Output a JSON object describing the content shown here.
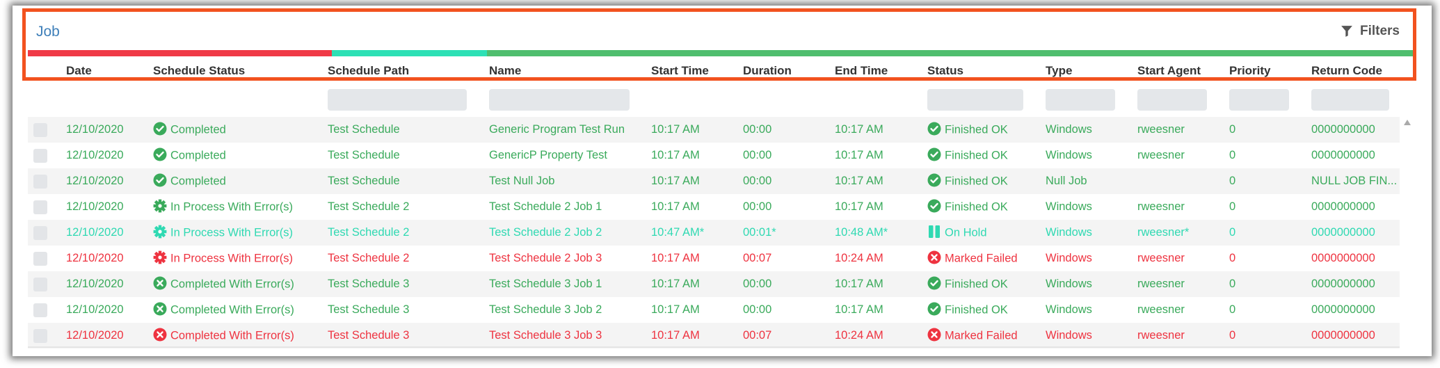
{
  "title": "Job",
  "filters_label": "Filters",
  "colors": {
    "completed": "#3aaa5b",
    "onhold": "#2fd9b2",
    "failed": "#ee3340"
  },
  "status_bar": [
    {
      "color": "#f03a47"
    },
    {
      "color": "#2de0b5"
    },
    {
      "color": "#4fbe6e"
    }
  ],
  "columns": [
    "Date",
    "Schedule Status",
    "Schedule Path",
    "Name",
    "Start Time",
    "Duration",
    "End Time",
    "Status",
    "Type",
    "Start Agent",
    "Priority",
    "Return Code"
  ],
  "rows": [
    {
      "state": "green",
      "date": "12/10/2020",
      "sched_icon": "check-circle-icon",
      "sched_status": "Completed",
      "path": "Test Schedule",
      "name": "Generic Program Test Run",
      "start": "10:17 AM",
      "duration": "00:00",
      "end": "10:17 AM",
      "status_icon": "check-circle-icon",
      "status": "Finished OK",
      "type": "Windows",
      "agent": "rweesner",
      "priority": "0",
      "code": "0000000000"
    },
    {
      "state": "green",
      "date": "12/10/2020",
      "sched_icon": "check-circle-icon",
      "sched_status": "Completed",
      "path": "Test Schedule",
      "name": "GenericP Property Test",
      "start": "10:17 AM",
      "duration": "00:00",
      "end": "10:17 AM",
      "status_icon": "check-circle-icon",
      "status": "Finished OK",
      "type": "Windows",
      "agent": "rweesner",
      "priority": "0",
      "code": "0000000000"
    },
    {
      "state": "green",
      "date": "12/10/2020",
      "sched_icon": "check-circle-icon",
      "sched_status": "Completed",
      "path": "Test Schedule",
      "name": "Test Null Job",
      "start": "10:17 AM",
      "duration": "00:00",
      "end": "10:17 AM",
      "status_icon": "check-circle-icon",
      "status": "Finished OK",
      "type": "Null Job",
      "agent": "",
      "priority": "0",
      "code": "NULL JOB FIN..."
    },
    {
      "state": "green",
      "date": "12/10/2020",
      "sched_icon": "gear-icon",
      "sched_status": "In Process With Error(s)",
      "path": "Test Schedule 2",
      "name": "Test Schedule 2 Job 1",
      "start": "10:17 AM",
      "duration": "00:00",
      "end": "10:17 AM",
      "status_icon": "check-circle-icon",
      "status": "Finished OK",
      "type": "Windows",
      "agent": "rweesner",
      "priority": "0",
      "code": "0000000000"
    },
    {
      "state": "teal",
      "date": "12/10/2020",
      "sched_icon": "gear-icon",
      "sched_status": "In Process With Error(s)",
      "path": "Test Schedule 2",
      "name": "Test Schedule 2 Job 2",
      "start": "10:47 AM*",
      "duration": "00:01*",
      "end": "10:48 AM*",
      "status_icon": "pause-icon",
      "status": "On Hold",
      "type": "Windows",
      "agent": "rweesner*",
      "priority": "0",
      "code": "0000000000"
    },
    {
      "state": "red",
      "date": "12/10/2020",
      "sched_icon": "gear-icon",
      "sched_status": "In Process With Error(s)",
      "path": "Test Schedule 2",
      "name": "Test Schedule 2 Job 3",
      "start": "10:17 AM",
      "duration": "00:07",
      "end": "10:24 AM",
      "status_icon": "x-circle-icon",
      "status": "Marked Failed",
      "type": "Windows",
      "agent": "rweesner",
      "priority": "0",
      "code": "0000000000"
    },
    {
      "state": "green",
      "date": "12/10/2020",
      "sched_icon": "x-circle-icon",
      "sched_status": "Completed With Error(s)",
      "path": "Test Schedule 3",
      "name": "Test Schedule 3 Job 1",
      "start": "10:17 AM",
      "duration": "00:00",
      "end": "10:17 AM",
      "status_icon": "check-circle-icon",
      "status": "Finished OK",
      "type": "Windows",
      "agent": "rweesner",
      "priority": "0",
      "code": "0000000000"
    },
    {
      "state": "green",
      "date": "12/10/2020",
      "sched_icon": "x-circle-icon",
      "sched_status": "Completed With Error(s)",
      "path": "Test Schedule 3",
      "name": "Test Schedule 3 Job 2",
      "start": "10:17 AM",
      "duration": "00:00",
      "end": "10:17 AM",
      "status_icon": "check-circle-icon",
      "status": "Finished OK",
      "type": "Windows",
      "agent": "rweesner",
      "priority": "0",
      "code": "0000000000"
    },
    {
      "state": "red",
      "date": "12/10/2020",
      "sched_icon": "x-circle-icon",
      "sched_status": "Completed With Error(s)",
      "path": "Test Schedule 3",
      "name": "Test Schedule 3 Job 3",
      "start": "10:17 AM",
      "duration": "00:07",
      "end": "10:24 AM",
      "status_icon": "x-circle-icon",
      "status": "Marked Failed",
      "type": "Windows",
      "agent": "rweesner",
      "priority": "0",
      "code": "0000000000"
    }
  ]
}
